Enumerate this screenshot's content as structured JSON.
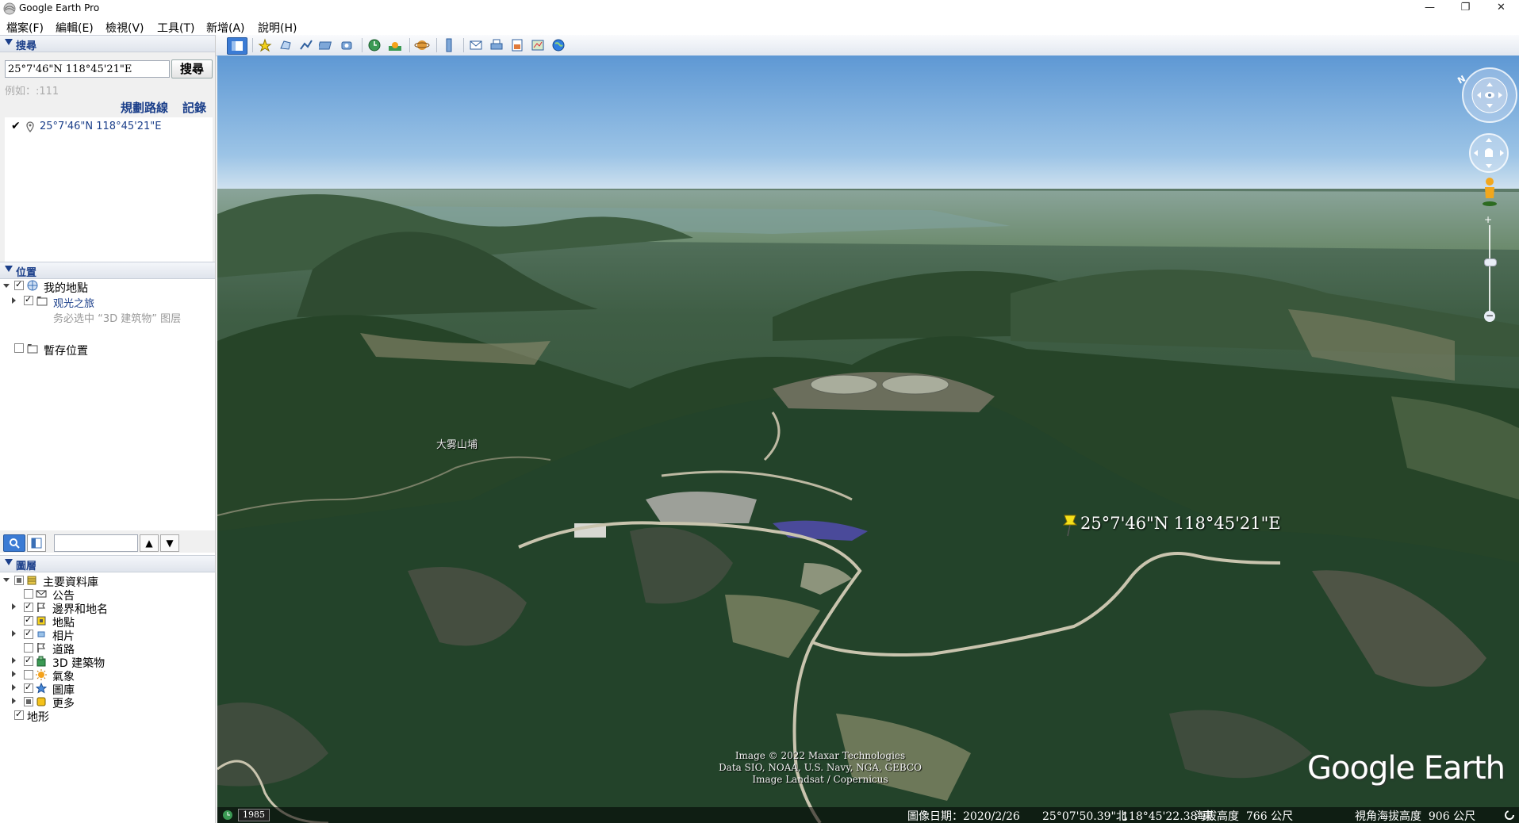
{
  "window": {
    "title": "Google Earth Pro"
  },
  "menu": [
    "檔案(F)",
    "編輯(E)",
    "檢視(V)",
    "工具(T)",
    "新增(A)",
    "說明(H)"
  ],
  "search": {
    "header": "搜尋",
    "query": "25°7'46\"N 118°45'21\"E",
    "button": "搜尋",
    "placeholder_hint": "例如：:111",
    "link_directions": "規劃路線",
    "link_history": "記錄",
    "result": "25°7'46\"N 118°45'21\"E"
  },
  "places": {
    "header": "位置",
    "my_places": "我的地點",
    "folder_tour": "观光之旅",
    "folder_tour_note": "务必选中 “3D 建筑物” 图层",
    "temporary": "暫存位置"
  },
  "layers": {
    "header": "圖層",
    "items": [
      {
        "label": "主要資料庫",
        "level": 0,
        "check": "partial",
        "expand": "down",
        "icon": "database-icon"
      },
      {
        "label": "公告",
        "level": 1,
        "check": "none",
        "expand": "",
        "icon": "envelope-icon"
      },
      {
        "label": "邊界和地名",
        "level": 1,
        "check": "checked",
        "expand": "right",
        "icon": "flag-icon"
      },
      {
        "label": "地點",
        "level": 1,
        "check": "checked",
        "expand": "",
        "icon": "place-icon"
      },
      {
        "label": "相片",
        "level": 1,
        "check": "checked",
        "expand": "right",
        "icon": "photo-icon"
      },
      {
        "label": "道路",
        "level": 1,
        "check": "none",
        "expand": "",
        "icon": "road-icon"
      },
      {
        "label": "3D 建築物",
        "level": 1,
        "check": "checked",
        "expand": "right",
        "icon": "building-icon"
      },
      {
        "label": "氣象",
        "level": 1,
        "check": "none",
        "expand": "right",
        "icon": "weather-icon"
      },
      {
        "label": "圖庫",
        "level": 1,
        "check": "checked",
        "expand": "right",
        "icon": "star-icon"
      },
      {
        "label": "更多",
        "level": 1,
        "check": "partial",
        "expand": "right",
        "icon": "more-icon"
      },
      {
        "label": "地形",
        "level": 0,
        "check": "checked",
        "expand": "",
        "icon": ""
      }
    ]
  },
  "map": {
    "placemark_label": "25°7'46\"N 118°45'21\"E",
    "place_name": "大雾山埔",
    "attribution": [
      "Image © 2022 Maxar Technologies",
      "Data SIO, NOAA, U.S. Navy, NGA, GEBCO",
      "Image Landsat / Copernicus"
    ],
    "logo": "Google Earth",
    "compass_letter": "N"
  },
  "status": {
    "year": "1985",
    "imagery_date": "圖像日期：2020/2/26",
    "lat": "25°07'50.39\"北",
    "lon": "118°45'22.38\"東",
    "elevation": "海拔高度  766 公尺",
    "eye_alt": "視角海拔高度  906 公尺"
  },
  "colors": {
    "header_text": "#1b3f8a",
    "sky_top": "#6aa2d8",
    "sky_bottom": "#d6e6f2",
    "link": "#1b3f8a"
  }
}
